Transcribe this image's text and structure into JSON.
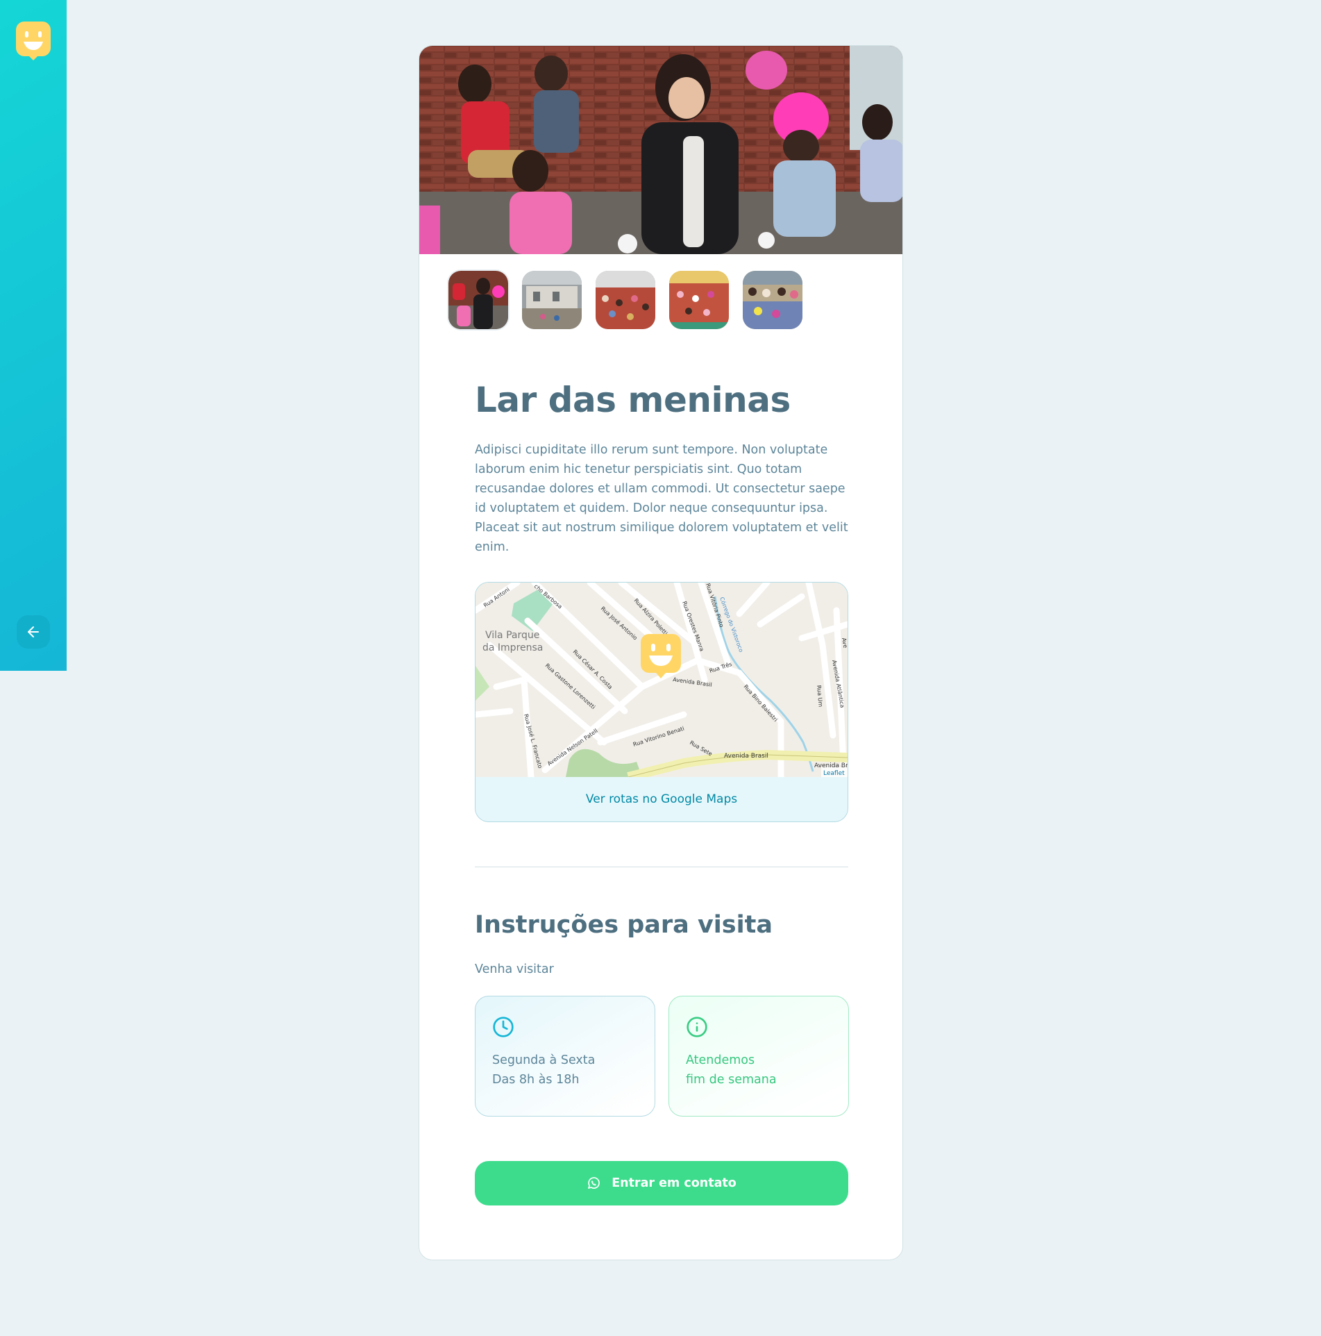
{
  "brand": {
    "accent": "#15C3D6",
    "marker": "#FFD666"
  },
  "sidebar": {
    "logo_icon": "happy-face-logo",
    "back_icon": "arrow-left-icon"
  },
  "orphanage": {
    "name": "Lar das meninas",
    "about": "Adipisci cupiditate illo rerum sunt tempore. Non voluptate laborum enim hic tenetur perspiciatis sint. Quo totam recusandae dolores et ullam commodi. Ut consectetur saepe id voluptatem et quidem. Dolor neque consequuntur ipsa. Placeat sit aut nostrum similique dolorem voluptatem et velit enim.",
    "images_count": 5,
    "active_image": 0
  },
  "map": {
    "place_label_1": "Vila Parque",
    "place_label_2": "da Imprensa",
    "streets": [
      "Rua Antoni",
      "cho Barbosa",
      "Rua José Antonio",
      "Rua Alzira Poletti",
      "Rua Orestes Manra",
      "Rua Vitória Pinto",
      "Córrego do Vistoroco",
      "Rua César A. Costa",
      "Rua Gastone Lorenzetti",
      "Avenida Brasil",
      "Rua Três",
      "Rua Bino Balestri",
      "Rua Um",
      "Avenida Atlântica",
      "Rua José L. Francato",
      "Avenida Nelson Patell",
      "Rua Vitorino Benati",
      "Rua Sete",
      "Avenida Brasil",
      "Avenida Br",
      "Ave"
    ],
    "attribution": "Leaflet",
    "directions_link": "Ver rotas no Google Maps"
  },
  "instructions": {
    "heading": "Instruções para visita",
    "text": "Venha visitar",
    "hours": {
      "icon": "clock-icon",
      "line1": "Segunda à Sexta",
      "line2": "Das 8h às 18h"
    },
    "weekend": {
      "icon": "info-icon",
      "line1": "Atendemos",
      "line2": "fim de semana"
    }
  },
  "contact_button": {
    "icon": "whatsapp-icon",
    "label": "Entrar em contato"
  }
}
